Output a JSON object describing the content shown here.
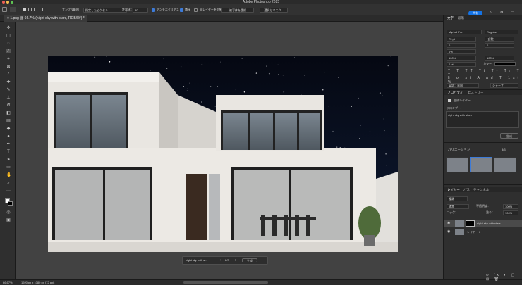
{
  "app": {
    "title": "Adobe Photoshop 2025"
  },
  "options_bar": {
    "sample_label": "サンプル範囲",
    "sample_value": "指定したピクセル",
    "tolerance_label": "許容値：",
    "tolerance_value": "30",
    "antialias_label": "アンチエイリアス",
    "contiguous_label": "隣接",
    "all_layers_label": "全レイヤーを対象",
    "select_subject_label": "被写体を選択",
    "select_mask_label": "選択とマスク...",
    "share_label": "共有"
  },
  "document": {
    "tab_title": "1.png @ 66.7% (night sky with stars, RGB/8#) *",
    "close_glyph": "×"
  },
  "status_bar": {
    "zoom": "66.67%",
    "dimensions": "1920 px x 1080 px (72 ppi)"
  },
  "taskbar": {
    "prompt": "night sky with s...",
    "page": "2/3",
    "generate_label": "生成",
    "more_label": "···"
  },
  "character_panel": {
    "tab_active": "文字",
    "tab_other": "段落",
    "font_family": "Myriad Pro",
    "font_style": "Regular",
    "font_size": "75 pt",
    "leading": "(自動)",
    "kerning": "0",
    "tracking": "0",
    "percent": "0%",
    "vscale": "100%",
    "hscale": "100%",
    "baseline": "0 pt",
    "color_label": "カラー:",
    "lang_value": "英語：米国",
    "aa_value": "シャープ"
  },
  "properties_panel": {
    "tab_active": "プロパティ",
    "tab_other": "ヒストリー",
    "layer_type": "生成レイヤー",
    "prompt_label": "プロンプト",
    "prompt_text": "night sky with stars",
    "generate_label": "生成",
    "variations_label": "バリエーション",
    "variations_count": "3/3"
  },
  "layers_panel": {
    "tab_active": "レイヤー",
    "tab_paths": "パス",
    "tab_channels": "チャンネル",
    "filter_label": "種類",
    "blend_mode": "通常",
    "opacity_label": "不透明度：",
    "opacity_value": "100%",
    "lock_label": "ロック：",
    "fill_label": "塗り：",
    "fill_value": "100%",
    "layers": [
      {
        "name": "night sky with stars"
      },
      {
        "name": "レイヤー 0"
      }
    ]
  },
  "colors": {
    "accent": "#1473e6",
    "sky": "#0a0f1f",
    "wall": "#e9e6e1"
  }
}
